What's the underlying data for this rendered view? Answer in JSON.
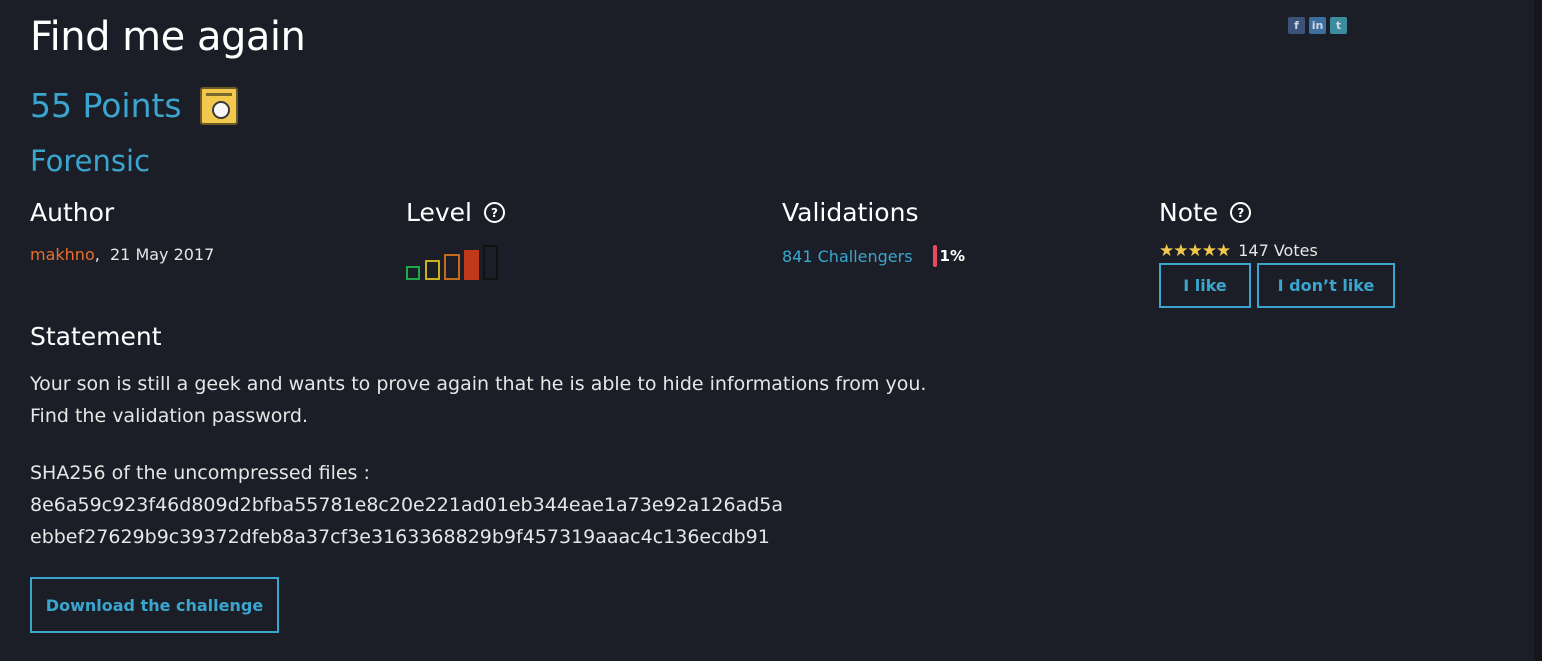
{
  "challenge": {
    "title": "Find me again",
    "points": "55 Points",
    "category": "Forensic"
  },
  "share": {
    "facebook": "f",
    "linkedin": "in",
    "twitter": "t"
  },
  "author": {
    "heading": "Author",
    "name": "makhno",
    "separator": ",",
    "date": "21 May 2017"
  },
  "level": {
    "heading": "Level",
    "help": "?",
    "bars": [
      {
        "color": "#1fa84a",
        "filled": false
      },
      {
        "color": "#c9b21f",
        "filled": false
      },
      {
        "color": "#c46a1c",
        "filled": false
      },
      {
        "color": "#c0391b",
        "filled": true
      },
      {
        "color": "#111111",
        "filled": false
      }
    ]
  },
  "validations": {
    "heading": "Validations",
    "challengers": "841 Challengers",
    "percent": "1%"
  },
  "note": {
    "heading": "Note",
    "help": "?",
    "stars": "★★★★★",
    "votes": "147 Votes",
    "like_label": "I like",
    "dislike_label": "I don’t like"
  },
  "statement": {
    "heading": "Statement",
    "line1": "Your son is still a geek and wants to prove again that he is able to hide informations from you.",
    "line2": "Find the validation password.",
    "sha_label": "SHA256 of the uncompressed files :",
    "sha1": "8e6a59c923f46d809d2bfba55781e8c20e221ad01eb344eae1a73e92a126ad5a",
    "sha2": "ebbef27629b9c39372dfeb8a37cf3e3163368829b9f457319aaac4c136ecdb91"
  },
  "download_label": "Download the challenge",
  "colors": {
    "accent": "#3aa6cf",
    "author": "#e8702a",
    "background": "#1b1e26",
    "star": "#f2c94c"
  }
}
